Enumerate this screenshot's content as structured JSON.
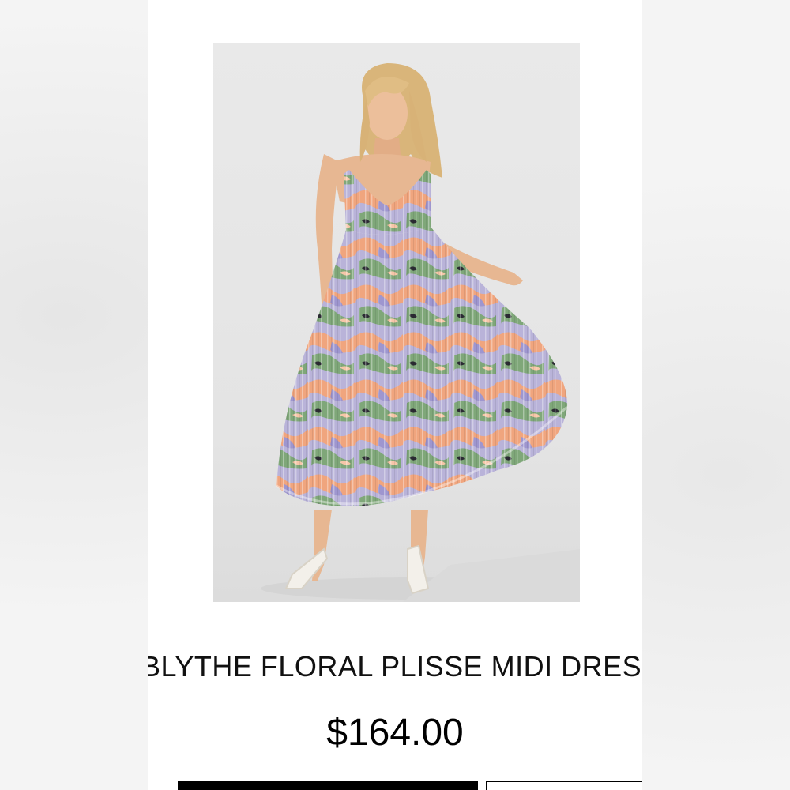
{
  "product": {
    "title": "BLYTHE FLORAL PLISSE MIDI DRESS",
    "price": "$164.00",
    "image_alt_icon": "dress-photo"
  },
  "colors": {
    "page_background": "#f4f4f4",
    "card_background": "#ffffff",
    "photo_background": "#e6e6e6",
    "text": "#111111",
    "button_primary": "#000000"
  }
}
